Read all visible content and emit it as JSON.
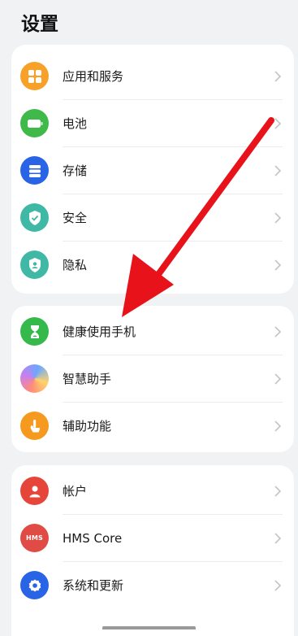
{
  "page": {
    "title": "设置"
  },
  "group1": [
    {
      "label": "应用和服务",
      "icon": "apps-grid-icon",
      "color": "#f7a128"
    },
    {
      "label": "电池",
      "icon": "battery-icon",
      "color": "#3fba4a"
    },
    {
      "label": "存储",
      "icon": "storage-icon",
      "color": "#2a64e6"
    },
    {
      "label": "安全",
      "icon": "shield-icon",
      "color": "#3fb8a6"
    },
    {
      "label": "隐私",
      "icon": "privacy-shield-icon",
      "color": "#3fb8a6"
    }
  ],
  "group2": [
    {
      "label": "健康使用手机",
      "icon": "hourglass-icon",
      "color": "#35b94a"
    },
    {
      "label": "智慧助手",
      "icon": "assistant-orb-icon",
      "color": "#c77ff0"
    },
    {
      "label": "辅助功能",
      "icon": "hand-pointer-icon",
      "color": "#f59a1e"
    }
  ],
  "group3": [
    {
      "label": "帐户",
      "icon": "account-person-icon",
      "color": "#e6453a"
    },
    {
      "label": "HMS Core",
      "icon": "hms-icon",
      "icon_text": "HMS",
      "color": "#e14b45"
    },
    {
      "label": "系统和更新",
      "icon": "system-gear-icon",
      "color": "#2a64e6"
    }
  ],
  "annotation": {
    "arrow_color": "#e8121b",
    "description": "red-arrow-pointing-to-health"
  }
}
